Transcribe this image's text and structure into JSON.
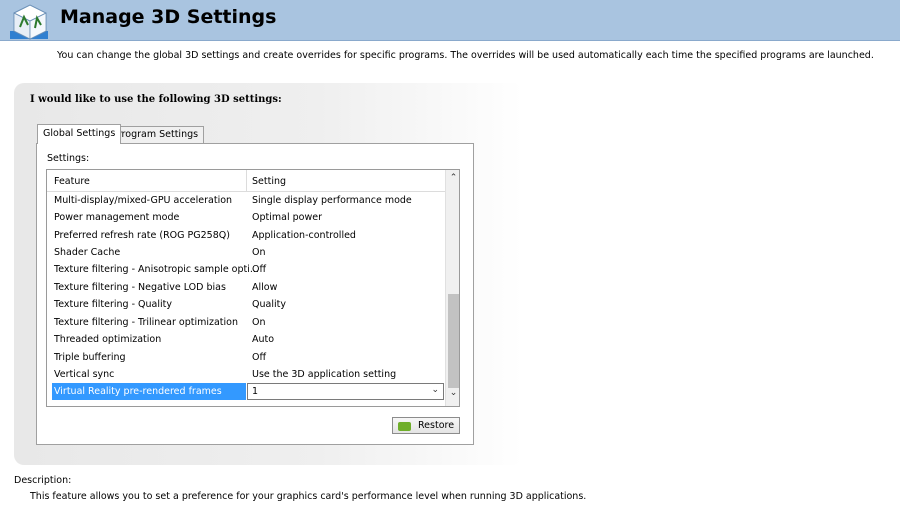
{
  "header": {
    "title": "Manage 3D Settings",
    "icon": "nvidia-3d-cube-icon",
    "background_color": "#a9c4e0"
  },
  "intro_text": "You can change the global 3D settings and create overrides for specific programs. The overrides will be used automatically each time the specified programs are launched.",
  "panel": {
    "heading": "I would like to use the following 3D settings:",
    "tabs": [
      {
        "label": "Global Settings",
        "active": true
      },
      {
        "label": "Program Settings",
        "active": false
      }
    ],
    "settings_label": "Settings:",
    "grid": {
      "columns": [
        "Feature",
        "Setting"
      ],
      "rows": [
        {
          "feature": "Multi-display/mixed-GPU acceleration",
          "setting": "Single display performance mode"
        },
        {
          "feature": "Power management mode",
          "setting": "Optimal power"
        },
        {
          "feature": "Preferred refresh rate (ROG PG258Q)",
          "setting": "Application-controlled"
        },
        {
          "feature": "Shader Cache",
          "setting": "On"
        },
        {
          "feature": "Texture filtering - Anisotropic sample opti...",
          "setting": "Off"
        },
        {
          "feature": "Texture filtering - Negative LOD bias",
          "setting": "Allow"
        },
        {
          "feature": "Texture filtering - Quality",
          "setting": "Quality"
        },
        {
          "feature": "Texture filtering - Trilinear optimization",
          "setting": "On"
        },
        {
          "feature": "Threaded optimization",
          "setting": "Auto"
        },
        {
          "feature": "Triple buffering",
          "setting": "Off"
        },
        {
          "feature": "Vertical sync",
          "setting": "Use the 3D application setting"
        },
        {
          "feature": "Virtual Reality pre-rendered frames",
          "setting": "1",
          "selected": true
        }
      ],
      "selection_color": "#3399ff"
    },
    "restore_label": "Restore"
  },
  "description": {
    "label": "Description:",
    "text": "This feature allows you to set a preference for your graphics card's performance level when running 3D applications."
  }
}
